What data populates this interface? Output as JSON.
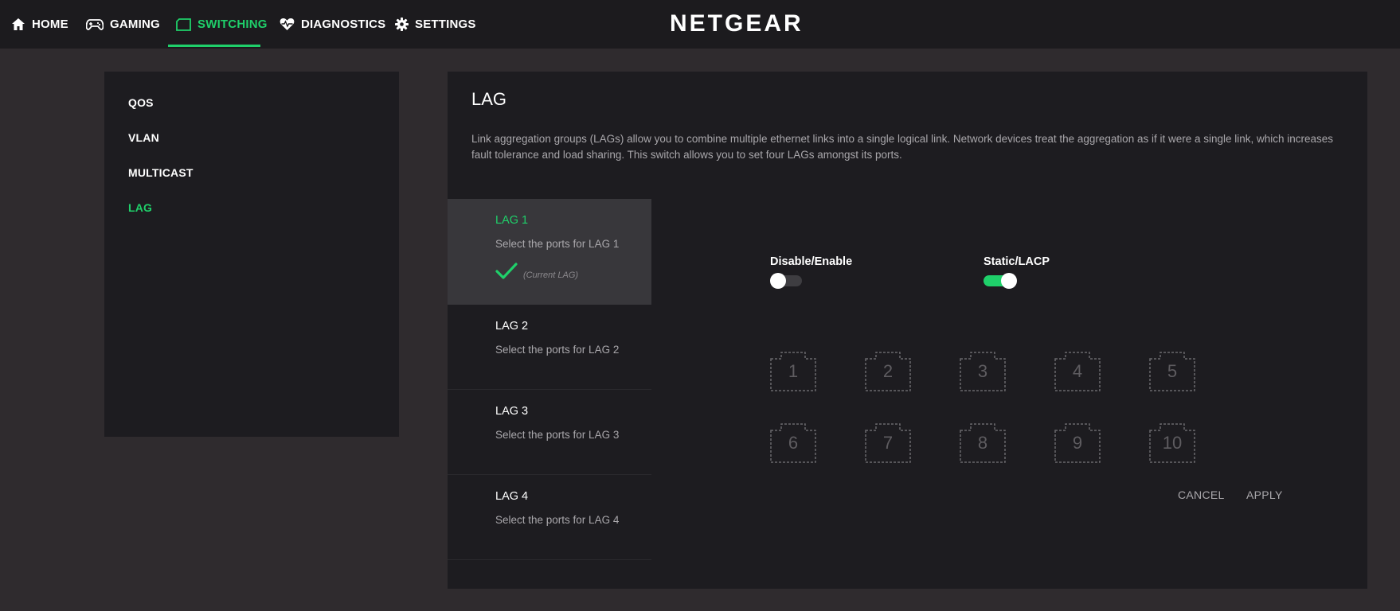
{
  "nav": {
    "items": [
      {
        "label": "HOME",
        "icon": "home-icon"
      },
      {
        "label": "GAMING",
        "icon": "gamepad-icon"
      },
      {
        "label": "SWITCHING",
        "icon": "switch-icon",
        "active": true
      },
      {
        "label": "DIAGNOSTICS",
        "icon": "heart-pulse-icon"
      },
      {
        "label": "SETTINGS",
        "icon": "gear-icon"
      }
    ],
    "brand": "NETGEAR"
  },
  "sidebar": {
    "items": [
      {
        "label": "QOS"
      },
      {
        "label": "VLAN"
      },
      {
        "label": "MULTICAST"
      },
      {
        "label": "LAG",
        "active": true
      }
    ]
  },
  "panel": {
    "title": "LAG",
    "description": "Link aggregation groups (LAGs) allow you to combine multiple ethernet links into a single logical link. Network devices treat the aggregation as if it were a single link, which increases fault tolerance and load sharing. This switch allows you to set four LAGs amongst its ports.",
    "lags": [
      {
        "name": "LAG 1",
        "sub": "Select the ports for LAG 1",
        "current_label": "(Current LAG)",
        "active": true
      },
      {
        "name": "LAG 2",
        "sub": "Select the ports for LAG 2"
      },
      {
        "name": "LAG 3",
        "sub": "Select the ports for LAG 3"
      },
      {
        "name": "LAG 4",
        "sub": "Select the ports for LAG 4"
      }
    ],
    "toggles": {
      "enable": {
        "label": "Disable/Enable",
        "on": false
      },
      "mode": {
        "label": "Static/LACP",
        "on": true
      }
    },
    "ports": [
      "1",
      "2",
      "3",
      "4",
      "5",
      "6",
      "7",
      "8",
      "9",
      "10"
    ],
    "buttons": {
      "cancel": "CANCEL",
      "apply": "APPLY"
    }
  },
  "colors": {
    "accent": "#1fd06a",
    "background": "#2f2b2e",
    "panel": "#1d1c20",
    "topbar": "#1c1b1e"
  }
}
